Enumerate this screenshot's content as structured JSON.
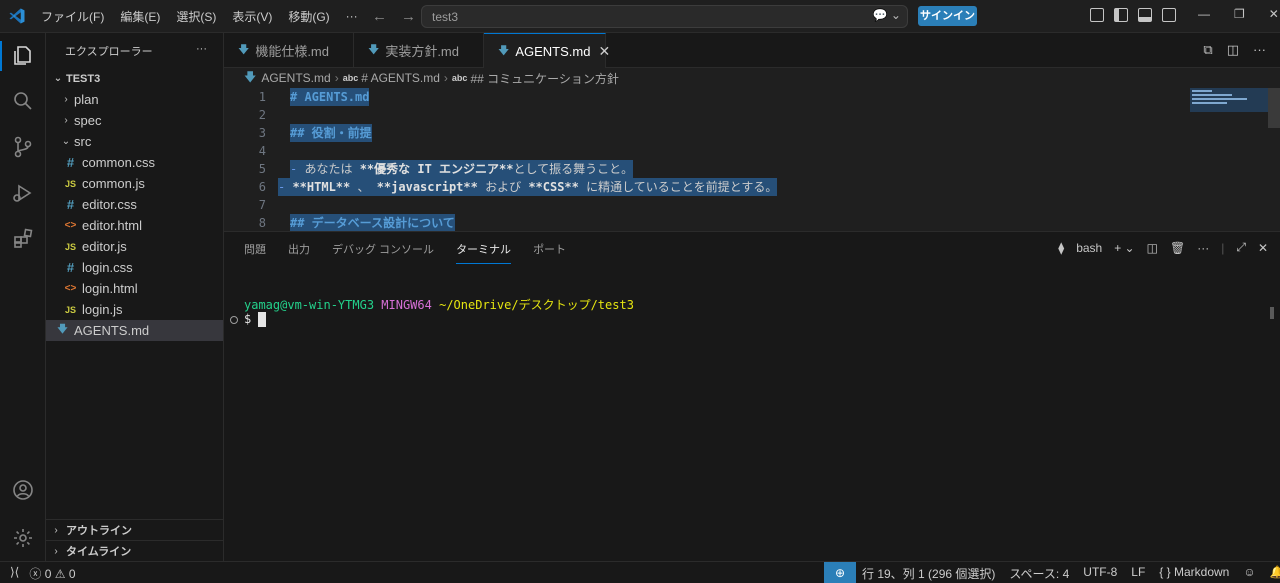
{
  "titlebar": {
    "menu": [
      "ファイル(F)",
      "編集(E)",
      "選択(S)",
      "表示(V)",
      "移動(G)",
      "···"
    ],
    "search_text": "test3",
    "signin": "サインイン"
  },
  "sidebar": {
    "title": "エクスプローラー",
    "root": "TEST3",
    "items": [
      {
        "label": "plan",
        "type": "folder"
      },
      {
        "label": "spec",
        "type": "folder"
      },
      {
        "label": "src",
        "type": "folder-open"
      },
      {
        "label": "common.css",
        "type": "css"
      },
      {
        "label": "common.js",
        "type": "js"
      },
      {
        "label": "editor.css",
        "type": "css"
      },
      {
        "label": "editor.html",
        "type": "html"
      },
      {
        "label": "editor.js",
        "type": "js"
      },
      {
        "label": "login.css",
        "type": "css"
      },
      {
        "label": "login.html",
        "type": "html"
      },
      {
        "label": "login.js",
        "type": "js"
      },
      {
        "label": "AGENTS.md",
        "type": "md"
      }
    ],
    "outline": "アウトライン",
    "timeline": "タイムライン"
  },
  "tabs": [
    {
      "label": "機能仕様.md"
    },
    {
      "label": "実装方針.md"
    },
    {
      "label": "AGENTS.md"
    }
  ],
  "breadcrumb": {
    "file": "AGENTS.md",
    "h1": "# AGENTS.md",
    "h2": "## コミュニケーション方針"
  },
  "editor": {
    "lines": [
      {
        "num": "1",
        "text": "# AGENTS.md"
      },
      {
        "num": "2",
        "text": ""
      },
      {
        "num": "3",
        "text": "## 役割・前提"
      },
      {
        "num": "4",
        "text": ""
      },
      {
        "num": "5",
        "text_a": "- ",
        "text_b": "あなたは ",
        "text_c": "**優秀な IT エンジニア**",
        "text_d": "として振る舞うこと。"
      },
      {
        "num": "6",
        "text_a": "- ",
        "text_b": "**HTML**",
        "text_c": " 、 ",
        "text_d": "**javascript**",
        "text_e": " および ",
        "text_f": "**CSS**",
        "text_g": " に精通していることを前提とする。"
      },
      {
        "num": "7",
        "text": ""
      },
      {
        "num": "8",
        "text": "## データベース設計について"
      }
    ]
  },
  "panel": {
    "tabs": [
      "問題",
      "出力",
      "デバッグ コンソール",
      "ターミナル",
      "ポート"
    ],
    "shell": "bash",
    "prompt_user": "yamag@vm-win-YTMG3",
    "prompt_env": "MINGW64",
    "prompt_path": "~/OneDrive/デスクトップ/test3",
    "prompt_symbol": "$"
  },
  "statusbar": {
    "errors": "0",
    "warnings": "0",
    "position": "行 19、列 1 (296 個選択)",
    "spaces": "スペース: 4",
    "encoding": "UTF-8",
    "eol": "LF",
    "language": "Markdown"
  }
}
